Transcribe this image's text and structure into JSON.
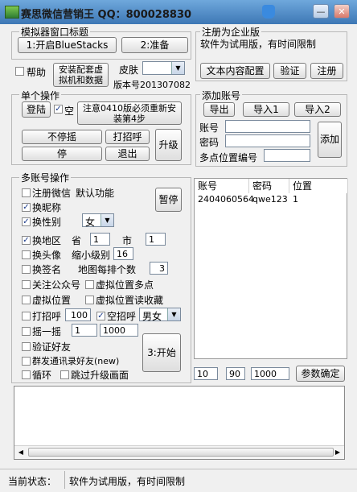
{
  "window": {
    "title": "赛思微信营销王 QQ：800028830",
    "minimize": "—",
    "close": "✕"
  },
  "simulator": {
    "legend": "模拟器窗口标题",
    "open_button": "1:开启BlueStacks",
    "prepare_button": "2:准备"
  },
  "register": {
    "legend": "注册为企业版",
    "note": "软件为试用版，有时间限制",
    "config_button": "文本内容配置",
    "verify_button": "验证",
    "register_button": "注册"
  },
  "misc": {
    "help_label": "帮助",
    "install_button": "安装配套虚拟机和数据",
    "skin_label": "皮肤",
    "skin_value": "",
    "version": "版本号201307082"
  },
  "single": {
    "legend": "单个操作",
    "login_button": "登陆",
    "empty_label": "空",
    "notice_button": "注意0410版必须重新安装第4步",
    "no_shake_button": "不停摇",
    "greet_button": "打招呼",
    "stop_button": "停",
    "exit_button": "退出",
    "upgrade_button": "升级"
  },
  "add_account": {
    "legend": "添加账号",
    "export_button": "导出",
    "import1_button": "导入1",
    "import2_button": "导入2",
    "account_label": "账号",
    "password_label": "密码",
    "location_label": "多点位置编号",
    "account_value": "",
    "password_value": "",
    "location_value": "",
    "add_button": "添加"
  },
  "multi": {
    "legend": "多账号操作",
    "register_wechat": "注册微信",
    "default_func": "默认功能",
    "pause_button": "暂停",
    "change_nick": "换昵称",
    "change_gender": "换性别",
    "gender_value": "女",
    "change_region": "换地区",
    "province_label": "省",
    "province_value": "1",
    "city_label": "市",
    "city_value": "1",
    "change_avatar": "换头像",
    "shrink_label": "缩小级别",
    "shrink_value": "16",
    "change_sign": "换签名",
    "map_label": "地图每排个数",
    "map_value": "3",
    "follow_public": "关注公众号",
    "virtual_multi": "虚拟位置多点",
    "virtual_location": "虚拟位置",
    "virtual_read": "虚拟位置读收藏",
    "greet": "打招呼",
    "greet_value": "100",
    "empty_greet": "空招呼",
    "greet_gender": "男女",
    "shake": "摇一摇",
    "shake_value1": "1",
    "shake_value2": "1000",
    "verify_friend": "验证好友",
    "mass_send": "群发通讯录好友(new)",
    "loop": "循环",
    "skip_upgrade": "跳过升级画面",
    "start_button": "3:开始"
  },
  "accounts_table": {
    "headers": [
      "账号",
      "密码",
      "位置"
    ],
    "rows": [
      [
        "2404060564",
        "qwe123",
        "1"
      ]
    ]
  },
  "params": {
    "v1": "10",
    "v2": "90",
    "v3": "1000",
    "confirm_button": "参数确定"
  },
  "log_text": "",
  "status": {
    "label": "当前状态：",
    "text": "软件为试用版，有时间限制"
  }
}
